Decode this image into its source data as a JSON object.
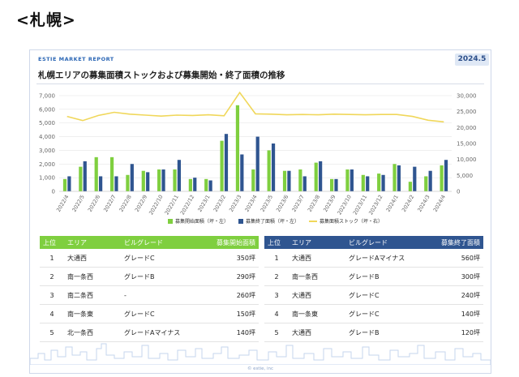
{
  "heading": "<札幌>",
  "card": {
    "report_label": "ESTIE MARKET REPORT",
    "date": "2024.5",
    "title": "札幌エリアの募集面積ストックおよび募集開始・終了面積の推移",
    "footer": "© estie, inc"
  },
  "colors": {
    "start": "#7fcf3f",
    "end": "#2f5590",
    "stock": "#f0d75a"
  },
  "chart_data": {
    "type": "bar+line",
    "categories": [
      "2022/4",
      "2022/5",
      "2022/6",
      "2022/7",
      "2022/8",
      "2022/9",
      "2022/10",
      "2022/11",
      "2022/12",
      "2023/1",
      "2023/2",
      "2023/3",
      "2023/4",
      "2023/5",
      "2023/6",
      "2023/7",
      "2023/8",
      "2023/9",
      "2023/10",
      "2023/11",
      "2023/12",
      "2024/1",
      "2024/2",
      "2024/3",
      "2024/4"
    ],
    "series": [
      {
        "name": "募集開始面積（坪・左）",
        "axis": "left",
        "values": [
          900,
          1800,
          2500,
          2500,
          1200,
          1500,
          1600,
          1600,
          900,
          900,
          3700,
          6300,
          1600,
          3000,
          1500,
          1600,
          2100,
          900,
          1600,
          1200,
          1300,
          2000,
          700,
          1100,
          1900
        ]
      },
      {
        "name": "募集終了面積（坪・左）",
        "axis": "left",
        "values": [
          1100,
          2200,
          1100,
          1100,
          2000,
          1400,
          1600,
          2300,
          1000,
          800,
          4200,
          2700,
          4000,
          3500,
          1500,
          1100,
          2200,
          900,
          1600,
          1100,
          1200,
          1900,
          1800,
          1500,
          2300
        ]
      },
      {
        "name": "募集面積ストック（坪・右）",
        "axis": "right",
        "type": "line",
        "values": [
          23500,
          22200,
          23800,
          24800,
          24200,
          23900,
          23600,
          23900,
          23800,
          24000,
          23700,
          31000,
          24300,
          24200,
          24000,
          24100,
          24000,
          24200,
          24100,
          24000,
          24100,
          24100,
          23500,
          22300,
          21800
        ]
      }
    ],
    "ylim_left": [
      0,
      7000
    ],
    "yticks_left": [
      "0",
      "1,000",
      "2,000",
      "3,000",
      "4,000",
      "5,000",
      "6,000",
      "7,000"
    ],
    "ylim_right": [
      0,
      30000
    ],
    "yticks_right": [
      "0",
      "5,000",
      "10,000",
      "15,000",
      "20,000",
      "25,000",
      "30,000"
    ],
    "legend_position": "bottom"
  },
  "table_left": {
    "headers": [
      "上位",
      "エリア",
      "ビルグレード",
      "募集開始面積"
    ],
    "rows": [
      [
        "1",
        "大通西",
        "グレードC",
        "350坪"
      ],
      [
        "2",
        "南一条西",
        "グレードB",
        "290坪"
      ],
      [
        "3",
        "南二条西",
        "-",
        "260坪"
      ],
      [
        "4",
        "南一条東",
        "グレードC",
        "150坪"
      ],
      [
        "5",
        "北一条西",
        "グレードAマイナス",
        "140坪"
      ]
    ]
  },
  "table_right": {
    "headers": [
      "上位",
      "エリア",
      "ビルグレード",
      "募集終了面積"
    ],
    "rows": [
      [
        "1",
        "大通西",
        "グレードAマイナス",
        "560坪"
      ],
      [
        "2",
        "南一条西",
        "グレードB",
        "300坪"
      ],
      [
        "3",
        "大通西",
        "グレードC",
        "240坪"
      ],
      [
        "4",
        "南一条東",
        "グレードC",
        "140坪"
      ],
      [
        "5",
        "大通西",
        "グレードB",
        "120坪"
      ]
    ]
  }
}
